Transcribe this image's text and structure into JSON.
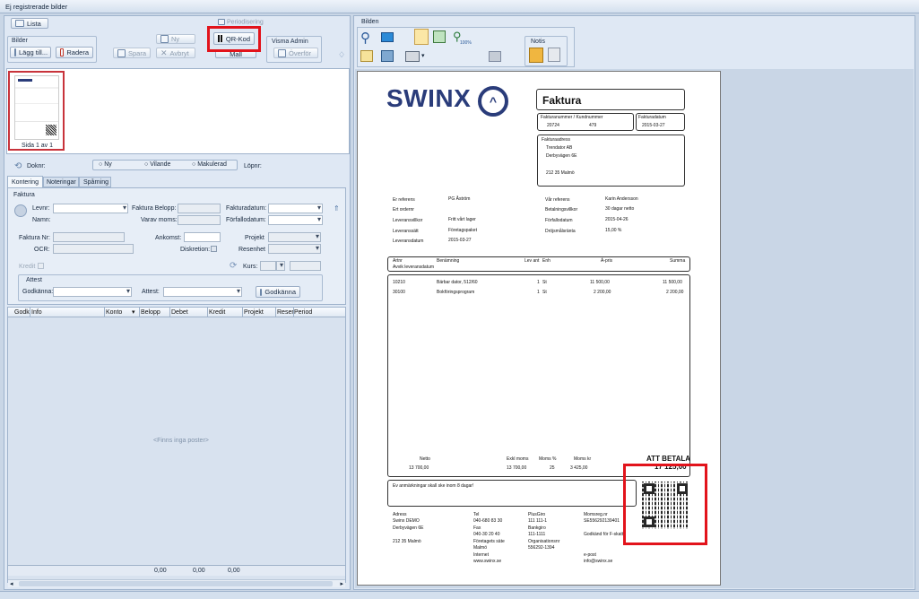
{
  "window": {
    "title": "Ej registrerade bilder"
  },
  "toolbar": {
    "lista": "Lista",
    "bilder_group": "Bilder",
    "lagg_till": "Lägg till...",
    "radera": "Radera",
    "ny": "Ny",
    "spara": "Spara",
    "avbryt": "Avbryt",
    "periodisering": "Periodisering",
    "qr_kod": "QR-Kod",
    "mall": "Mall",
    "visma_admin": "Visma Admin",
    "overfor": "Överför"
  },
  "thumbnail": {
    "caption": "Sida 1 av 1"
  },
  "dokument": {
    "doknr": "Doknr:",
    "ny": "Ny",
    "vilande": "Vilande",
    "makulerad": "Makulerad",
    "lopnr": "Löpnr:"
  },
  "tabs": [
    "Kontering",
    "Noteringar",
    "Spårning"
  ],
  "form": {
    "section": "Faktura",
    "levnr": "Levnr:",
    "namn": "Namn:",
    "faktura_belopp": "Faktura Belopp:",
    "varav_moms": "Varav moms:",
    "fakturadatum": "Fakturadatum:",
    "forfallodatum": "Förfallodatum:",
    "faktura_nr": "Faktura Nr:",
    "ocr": "OCR:",
    "ankomst": "Ankomst:",
    "diskretion": "Diskretion:",
    "projekt": "Projekt",
    "resenhet": "Resenhet",
    "kredit": "Kredit",
    "kurs": "Kurs:",
    "attest": "Attest",
    "godkanna": "Godkänna:",
    "attest_lbl": "Attest:",
    "godkanna_btn": "Godkänna"
  },
  "grid": {
    "columns": [
      "Godk",
      "Info",
      "Konto",
      "Belopp",
      "Debet",
      "Kredit",
      "Projekt",
      "Reser",
      "Period"
    ],
    "empty": "<Finns inga poster>",
    "sum1": "0,00",
    "sum2": "0,00",
    "sum3": "0,00"
  },
  "right_toolbar": {
    "bilden": "Bilden",
    "notis": "Notis",
    "zoom": "100%"
  },
  "invoice": {
    "logo": "SWINX",
    "title": "Faktura",
    "fakturanummer_label": "Fakturanummer / Kundnummer",
    "fakturanummer": "20724",
    "kundnummer": "479",
    "fakturadatum_label": "Fakturadatum",
    "fakturadatum": "2015-03-27",
    "adress_label": "Fakturaadress",
    "adress1": "Trendator AB",
    "adress2": "Derbyvägen 6E",
    "adress3": "212 35  Malmö",
    "er_referens": "Er referens",
    "er_referens_v": "PG Åström",
    "ert_ordernr": "Ert ordernr",
    "leveransvillkor": "Leveransvillkor",
    "leveransvillkor_v": "Fritt vårt lager",
    "leveranssatt": "Leveranssätt",
    "leveranssatt_v": "Företagspaket",
    "leveransdatum": "Leveransdatum",
    "leveransdatum_v": "2015-03-27",
    "var_referens": "Vår referens",
    "var_referens_v": "Karin Andersson",
    "betalningsvillkor": "Betalningsvillkor",
    "betalningsvillkor_v": "30 dagar netto",
    "forfallodatum": "Förfallodatum",
    "forfallodatum_v": "2015-04-26",
    "drojsmalsranta": "Dröjsmålsränta",
    "drojsmalsranta_v": "15,00 %",
    "col_artnr": "Artnr",
    "col_benamning": "Benämning",
    "col_levant": "Lev ant",
    "col_enh": "Enh",
    "col_apris": "Á-pris",
    "col_summa": "Summa",
    "avvik": "Avvik leveransdatum",
    "rows": [
      {
        "artnr": "10210",
        "ben": "Bärbar dator, 512/60",
        "ant": "1",
        "enh": "St",
        "pris": "11 500,00",
        "summa": "11 500,00"
      },
      {
        "artnr": "30100",
        "ben": "Bokföringsprogram",
        "ant": "1",
        "enh": "St",
        "pris": "2 200,00",
        "summa": "2 200,00"
      }
    ],
    "netto_label": "Netto",
    "netto": "13 700,00",
    "exkl_label": "Exkl moms",
    "exkl": "13 700,00",
    "moms_pct_label": "Moms %",
    "moms_pct": "25",
    "moms_kr_label": "Moms kr",
    "moms_kr": "3 425,00",
    "att_betala": "ATT BETALA",
    "total": "17 125,00",
    "note": "Ev anmärkningar skall ske inom 8 dagar!",
    "f_adress": "Adress",
    "f_adress1": "Swinx DEMO",
    "f_adress2": "Derbyvägen 6E",
    "f_adress3": "212 35  Malmö",
    "f_tel": "Tel",
    "f_tel_v": "040-680 83 30",
    "f_fax": "Fax",
    "f_fax_v": "040-30 20 40",
    "f_sate": "Företagets säte",
    "f_sate_v": "Malmö",
    "f_internet": "Internet",
    "f_internet_v": "www.swinx.se",
    "f_plusgiro": "PlusGiro",
    "f_plusgiro_v": "111 111-1",
    "f_bankgiro": "Bankgiro",
    "f_bankgiro_v": "111-1111",
    "f_orgnr": "Organisationsnr",
    "f_orgnr_v": "556292-1394",
    "f_momsreg": "Momsreg.nr",
    "f_momsreg_v": "SE556292139401",
    "f_godkand": "Godkänd för F-skatt",
    "f_epost": "e-post",
    "f_epost_v": "info@swinx.se"
  }
}
